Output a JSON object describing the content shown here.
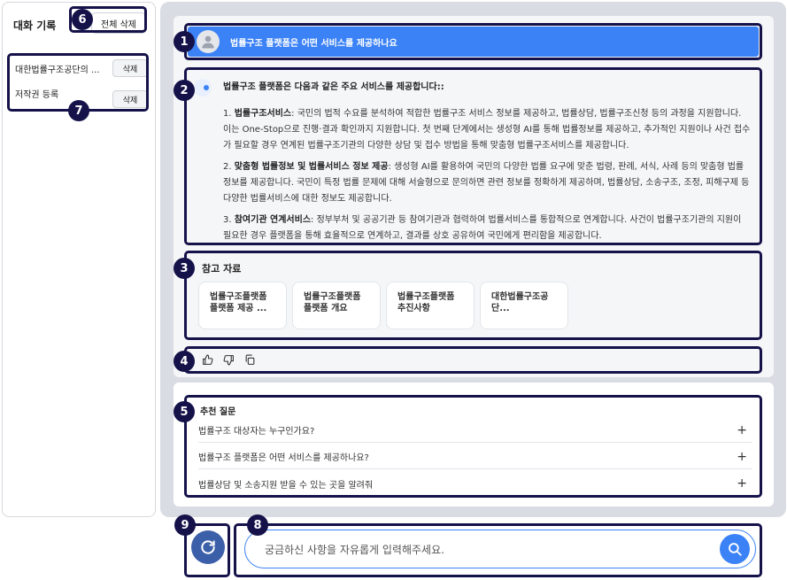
{
  "sidebar": {
    "title": "대화 기록",
    "delete_all_label": "전체 삭제",
    "conversations": [
      {
        "label": "대한법률구조공단의 ...",
        "delete_label": "삭제"
      },
      {
        "label": "저작권 등록",
        "delete_label": "삭제"
      }
    ]
  },
  "question": {
    "text": "법률구조 플랫폼은 어떤 서비스를 제공하나요"
  },
  "answer": {
    "heading": "법률구조 플랫폼은 다음과 같은 주요 서비스를 제공합니다::",
    "items": [
      {
        "num": "1.",
        "title": "법률구조서비스",
        "body": ": 국민의 법적 수요를 분석하여 적합한 법률구조 서비스 정보를 제공하고, 법률상담, 법률구조신청 등의 과정을 지원합니다. 이는 One-Stop으로 진행·결과 확인까지 지원합니다. 첫 번째 단계에서는 생성형 AI를 통해 법률정보를 제공하고, 추가적인 지원이나 사건 접수가 필요할 경우 연계된 법률구조기관의 다양한 상담 및 접수 방법을 통해 맞춤형 법률구조서비스를 제공합니다."
      },
      {
        "num": "2.",
        "title": "맞춤형 법률정보 및 법률서비스 정보 제공",
        "body": ": 생성형 AI를 활용하여 국민의 다양한 법률 요구에 맞춘 법령, 판례, 서식, 사례 등의 맞춤형 법률정보를 제공합니다. 국민이 특정 법률 문제에 대해 서술형으로 문의하면 관련 정보를 정확하게 제공하며, 법률상담, 소송구조, 조정, 피해구제 등 다양한 법률서비스에 대한 정보도 제공합니다."
      },
      {
        "num": "3.",
        "title": "참여기관 연계서비스",
        "body": ": 정부부처 및 공공기관 등 참여기관과 협력하여 법률서비스를 통합적으로 연계합니다. 사건이 법률구조기관의 지원이 필요한 경우 플랫폼을 통해 효율적으로 연계하고, 결과를 상호 공유하여 국민에게 편리함을 제공합니다."
      }
    ]
  },
  "references": {
    "title": "참고 자료",
    "cards": [
      {
        "line1": "법률구조플랫폼",
        "line2": "플랫폼 제공 ..."
      },
      {
        "line1": "법률구조플랫폼",
        "line2": "플랫폼 개요"
      },
      {
        "line1": "법률구조플랫폼",
        "line2": "추진사항"
      },
      {
        "line1": "대한법률구조공",
        "line2": "단..."
      }
    ]
  },
  "suggestions": {
    "title": "추천 질문",
    "items": [
      {
        "text": "법률구조 대상자는 누구인가요?",
        "icon": "+"
      },
      {
        "text": "법률구조 플랫폼은 어떤 서비스를 제공하나요?",
        "icon": "+"
      },
      {
        "text": "법률상담 및 소송지원 받을 수 있는 곳을 알려줘",
        "icon": "+"
      }
    ]
  },
  "input": {
    "placeholder": "궁금하신 사항을 자유롭게 입력해주세요."
  },
  "badges": [
    "1",
    "2",
    "3",
    "4",
    "5",
    "6",
    "7",
    "8",
    "9"
  ],
  "colors": {
    "accent": "#3b82f6",
    "highlight_border": "#15124a",
    "refresh": "#3b5fa8"
  }
}
